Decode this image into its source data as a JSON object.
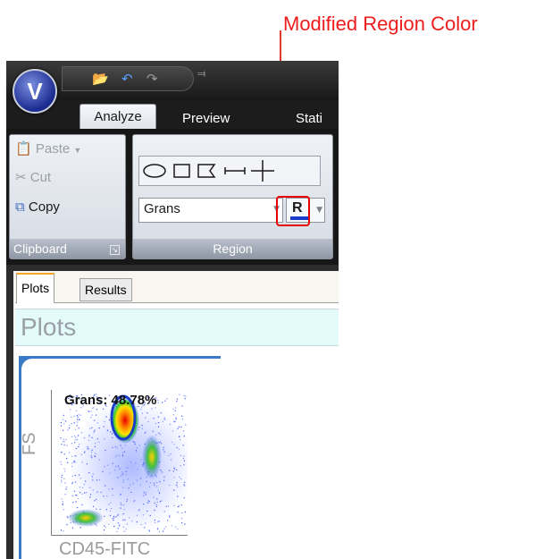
{
  "annotation": {
    "text": "Modified Region Color",
    "color": "#ee1c1c"
  },
  "app": {
    "logo_letter": "V",
    "quick_access": {
      "icons": [
        "folder-open-icon",
        "undo-icon",
        "redo-icon"
      ],
      "dropdown": "⫤"
    }
  },
  "tabs": [
    {
      "label": "Analyze",
      "active": true
    },
    {
      "label": "Preview",
      "active": false
    },
    {
      "label": "Stati",
      "active": false
    }
  ],
  "clipboard": {
    "paste_label": "Paste",
    "cut_label": "Cut",
    "copy_label": "Copy",
    "group_label": "Clipboard"
  },
  "region": {
    "shape_tools": [
      "ellipse-tool",
      "rectangle-tool",
      "polygon-tool",
      "line-segment-tool",
      "crosshair-tool"
    ],
    "selected_region": "Grans",
    "color_letter": "R",
    "color": "#1a3cc8",
    "group_label": "Region"
  },
  "content_tabs": [
    {
      "label": "Plots",
      "active": true
    },
    {
      "label": "Results",
      "active": false
    }
  ],
  "plots_title": "Plots",
  "plot": {
    "gate_label": "Grans: 48.78%",
    "x_axis": "CD45-FITC",
    "y_axis": "FS",
    "gate_color": "#1a3cc8"
  }
}
